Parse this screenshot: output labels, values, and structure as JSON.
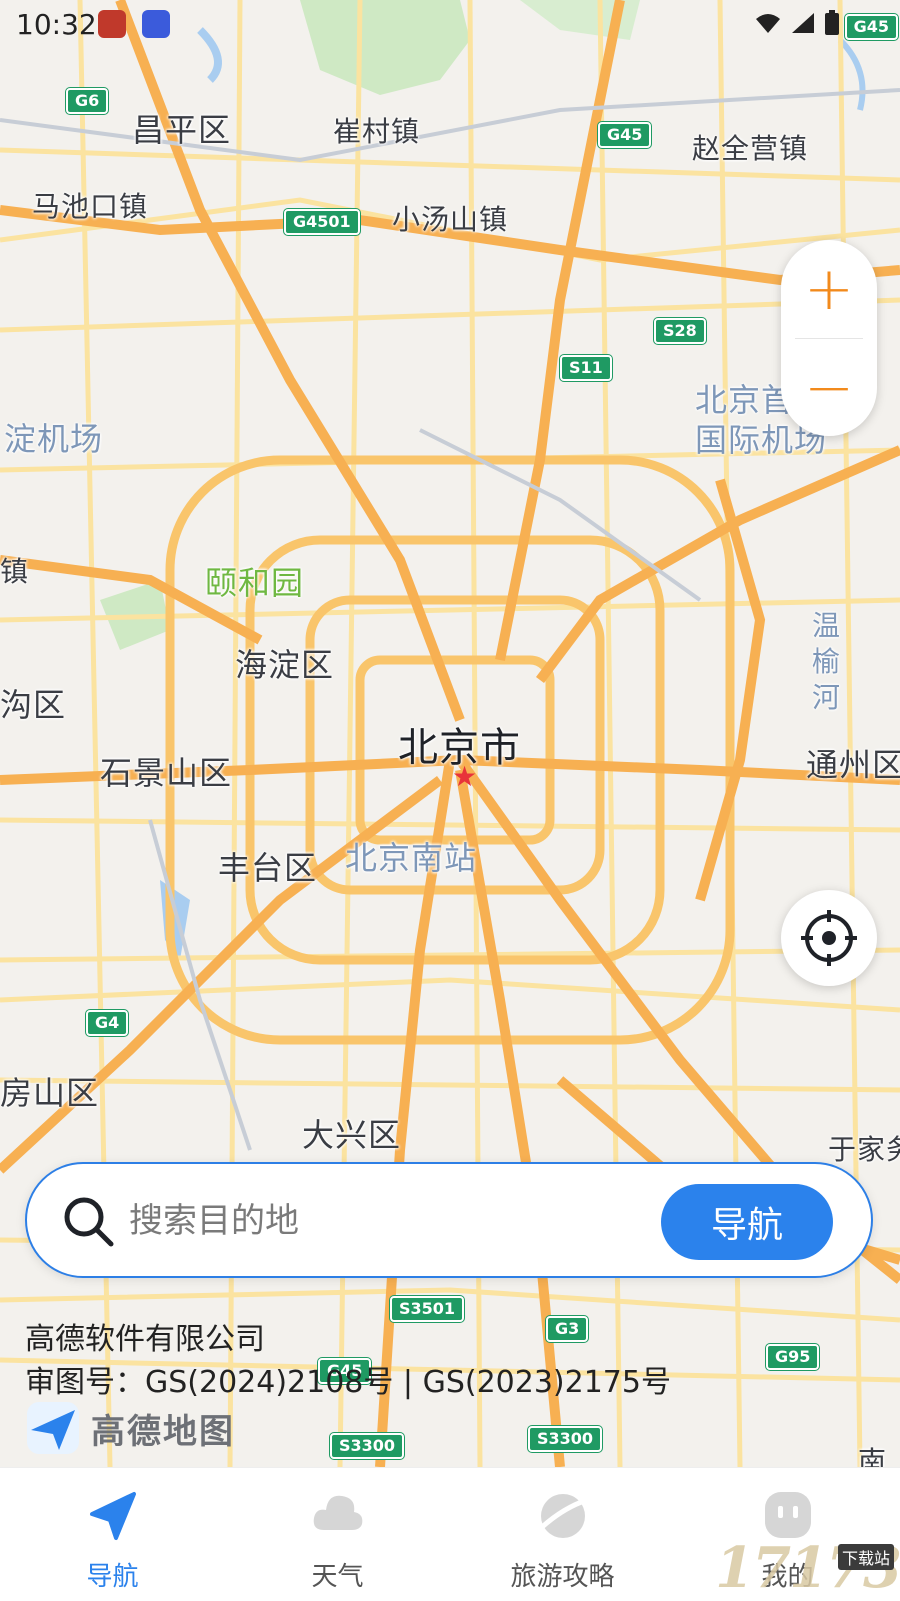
{
  "status_bar": {
    "time": "10:32",
    "right_badge": "G45"
  },
  "map": {
    "places": [
      {
        "name": "昌平区"
      },
      {
        "name": "崔村镇"
      },
      {
        "name": "赵全营镇"
      },
      {
        "name": "马池口镇"
      },
      {
        "name": "小汤山镇"
      },
      {
        "name": "淀机场"
      },
      {
        "name": "北京首"
      },
      {
        "name": "国际机场"
      },
      {
        "name": "颐和园"
      },
      {
        "name": "镇"
      },
      {
        "name": "海淀区"
      },
      {
        "name": "温榆河"
      },
      {
        "name": "沟区"
      },
      {
        "name": "北京市"
      },
      {
        "name": "石景山区"
      },
      {
        "name": "通州区"
      },
      {
        "name": "丰台区"
      },
      {
        "name": "北京南站"
      },
      {
        "name": "房山区"
      },
      {
        "name": "大兴区"
      },
      {
        "name": "于家务"
      },
      {
        "name": "南"
      }
    ],
    "shields": [
      "G6",
      "G45",
      "G4501",
      "S28",
      "S11",
      "G4",
      "S3501",
      "G3",
      "G95",
      "G45",
      "S3300",
      "S3300"
    ]
  },
  "zoom": {
    "in": "+",
    "out": "−"
  },
  "search": {
    "placeholder": "搜索目的地",
    "button": "导航"
  },
  "credits": {
    "company": "高德软件有限公司",
    "approval": "审图号：GS(2024)2108号 | GS(2023)2175号",
    "logo_text": "高德地图"
  },
  "bottom_nav": [
    {
      "label": "导航",
      "active": true,
      "icon": "navigation-arrow-icon"
    },
    {
      "label": "天气",
      "active": false,
      "icon": "cloud-icon"
    },
    {
      "label": "旅游攻略",
      "active": false,
      "icon": "planet-icon"
    },
    {
      "label": "我的",
      "active": false,
      "icon": "profile-icon"
    }
  ],
  "watermark": {
    "main": "17173",
    "sub": "下载站"
  },
  "colors": {
    "accent": "#2b82ec",
    "zoom": "#f28a1c",
    "road_major": "#f9b85a",
    "road_minor": "#fbe08a"
  }
}
